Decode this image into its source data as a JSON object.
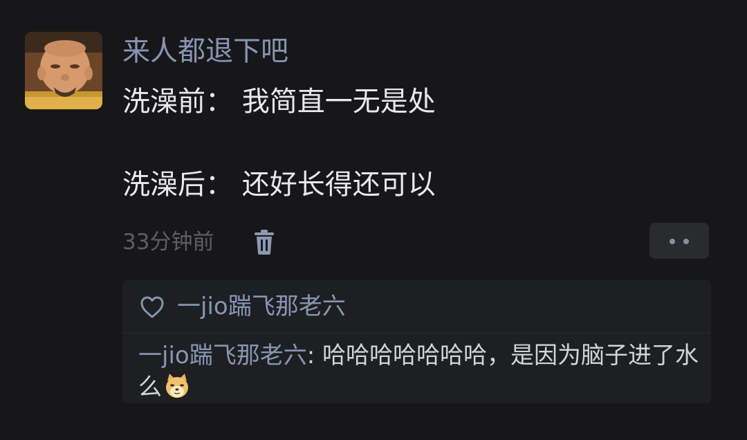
{
  "comment": {
    "username": "来人都退下吧",
    "line1": "洗澡前：  我简直一无是处",
    "line2": "洗澡后：  还好长得还可以",
    "timestamp": "33分钟前"
  },
  "icons": {
    "delete": "trash-icon",
    "more": "more-dots-icon",
    "like": "heart-outline-icon",
    "emoji": "doge-emoji"
  },
  "interactions": {
    "liked_by": "一jio踹飞那老六",
    "reply": {
      "author": "一jio踹飞那老六",
      "separator": ": ",
      "text": "哈哈哈哈哈哈哈，是因为脑子进了水么"
    }
  },
  "colors": {
    "background": "#171719",
    "username": "#8895b3",
    "text": "#e9e9ec",
    "meta": "#5d5f66",
    "panel": "#1e1f22"
  }
}
